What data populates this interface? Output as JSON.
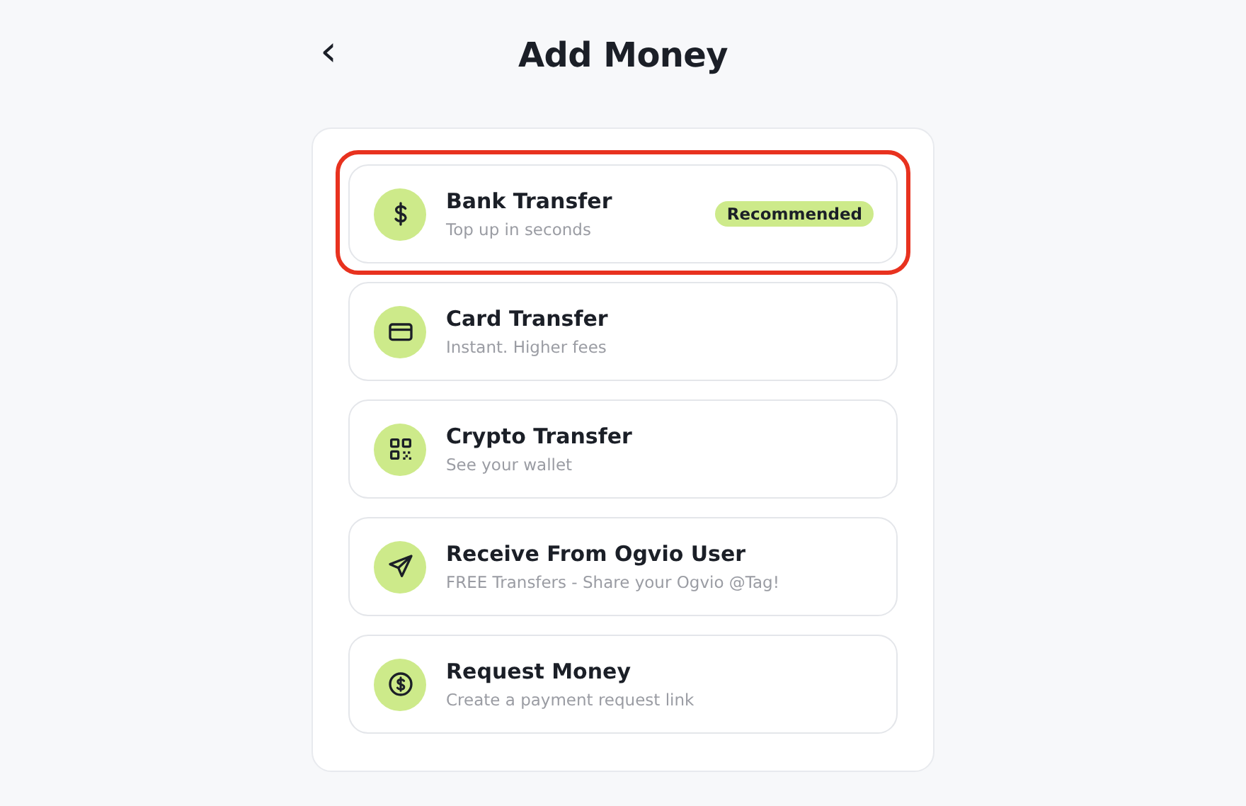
{
  "header": {
    "back": "‹",
    "title": "Add Money"
  },
  "options": [
    {
      "kind": "bank",
      "title": "Bank Transfer",
      "subtitle": "Top up in seconds",
      "badge": "Recommended",
      "highlighted": true
    },
    {
      "kind": "card",
      "title": "Card Transfer",
      "subtitle": "Instant. Higher fees",
      "highlighted": false
    },
    {
      "kind": "crypto",
      "title": "Crypto Transfer",
      "subtitle": "See your wallet",
      "highlighted": false
    },
    {
      "kind": "user",
      "title": "Receive From Ogvio User",
      "subtitle": "FREE Transfers - Share your Ogvio @Tag!",
      "highlighted": false
    },
    {
      "kind": "request",
      "title": "Request Money",
      "subtitle": "Create a payment request link",
      "highlighted": false
    }
  ]
}
